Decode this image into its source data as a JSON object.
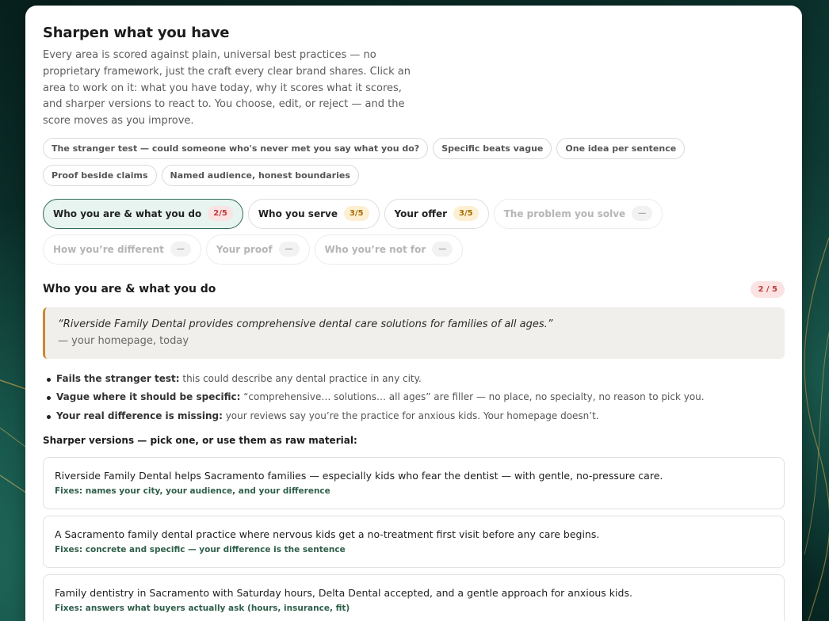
{
  "header": {
    "title": "Sharpen what you have",
    "intro": "Every area is scored against plain, universal best practices — no proprietary framework, just the craft every clear brand shares. Click an area to work on it: what you have today, why it scores what it scores, and sharper versions to react to. You choose, edit, or reject — and the score moves as you improve."
  },
  "principles": [
    "The stranger test — could someone who's never met you say what you do?",
    "Specific beats vague",
    "One idea per sentence",
    "Proof beside claims",
    "Named audience, honest boundaries"
  ],
  "tabs": [
    {
      "label": "Who you are & what you do",
      "score": "2/5"
    },
    {
      "label": "Who you serve",
      "score": "3/5"
    },
    {
      "label": "Your offer",
      "score": "3/5"
    },
    {
      "label": "The problem you solve",
      "score": "—"
    },
    {
      "label": "How you’re different",
      "score": "—"
    },
    {
      "label": "Your proof",
      "score": "—"
    },
    {
      "label": "Who you’re not for",
      "score": "—"
    }
  ],
  "section": {
    "title": "Who you are & what you do",
    "score": "2 / 5",
    "quote": "“Riverside Family Dental provides comprehensive dental care solutions for families of all ages.”",
    "quote_source": "— your homepage, today",
    "issues": [
      {
        "label": "Fails the stranger test:",
        "text": " this could describe any dental practice in any city."
      },
      {
        "label": "Vague where it should be specific:",
        "text": " “comprehensive… solutions… all ages” are filler — no place, no specialty, no reason to pick you."
      },
      {
        "label": "Your real difference is missing:",
        "text": " your reviews say you’re the practice for anxious kids. Your homepage doesn’t."
      }
    ],
    "versions_label": "Sharper versions — pick one, or use them as raw material:",
    "versions": [
      {
        "text": "Riverside Family Dental helps Sacramento families — especially kids who fear the dentist — with gentle, no-pressure care.",
        "fix": "Fixes: names your city, your audience, and your difference"
      },
      {
        "text": "A Sacramento family dental practice where nervous kids get a no-treatment first visit before any care begins.",
        "fix": "Fixes: concrete and specific — your difference is the sentence"
      },
      {
        "text": "Family dentistry in Sacramento with Saturday hours, Delta Dental accepted, and a gentle approach for anxious kids.",
        "fix": "Fixes: answers what buyers actually ask (hours, insurance, fit)"
      }
    ]
  },
  "colors": {
    "accent_green": "#2e6b55",
    "active_tab_bg": "#e8f4ef",
    "score_red": "#c03b3b",
    "score_amber": "#a86d06",
    "quote_border": "#c98a2e"
  }
}
